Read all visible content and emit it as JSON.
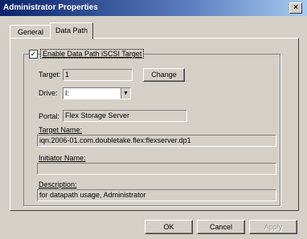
{
  "window": {
    "title": "Administrator Properties",
    "close_glyph": "×"
  },
  "tabs": [
    {
      "label": "General",
      "selected": false
    },
    {
      "label": "Data Path",
      "selected": true
    }
  ],
  "enable_checkbox": {
    "label": "Enable Data Path iSCSI Target",
    "checked": true,
    "glyph": "✓"
  },
  "target": {
    "label": "Target:",
    "value": "1",
    "change_button": "Change"
  },
  "drive": {
    "label": "Drive:",
    "value": "I:"
  },
  "portal": {
    "label": "Portal:",
    "value": "Flex Storage Server"
  },
  "target_name": {
    "label": "Target Name:",
    "value": "iqn.2006-01.com.doubletake.flex:flexserver.dp1"
  },
  "initiator_name": {
    "label": "Initiator Name:",
    "value": ""
  },
  "description": {
    "label": "Description:",
    "value": "for datapath usage, Administrator"
  },
  "buttons": {
    "ok": "OK",
    "cancel": "Cancel",
    "apply": "Apply"
  },
  "icons": {
    "dropdown_arrow": "▼",
    "checkmark": "checkmark-icon",
    "close": "close-icon"
  }
}
